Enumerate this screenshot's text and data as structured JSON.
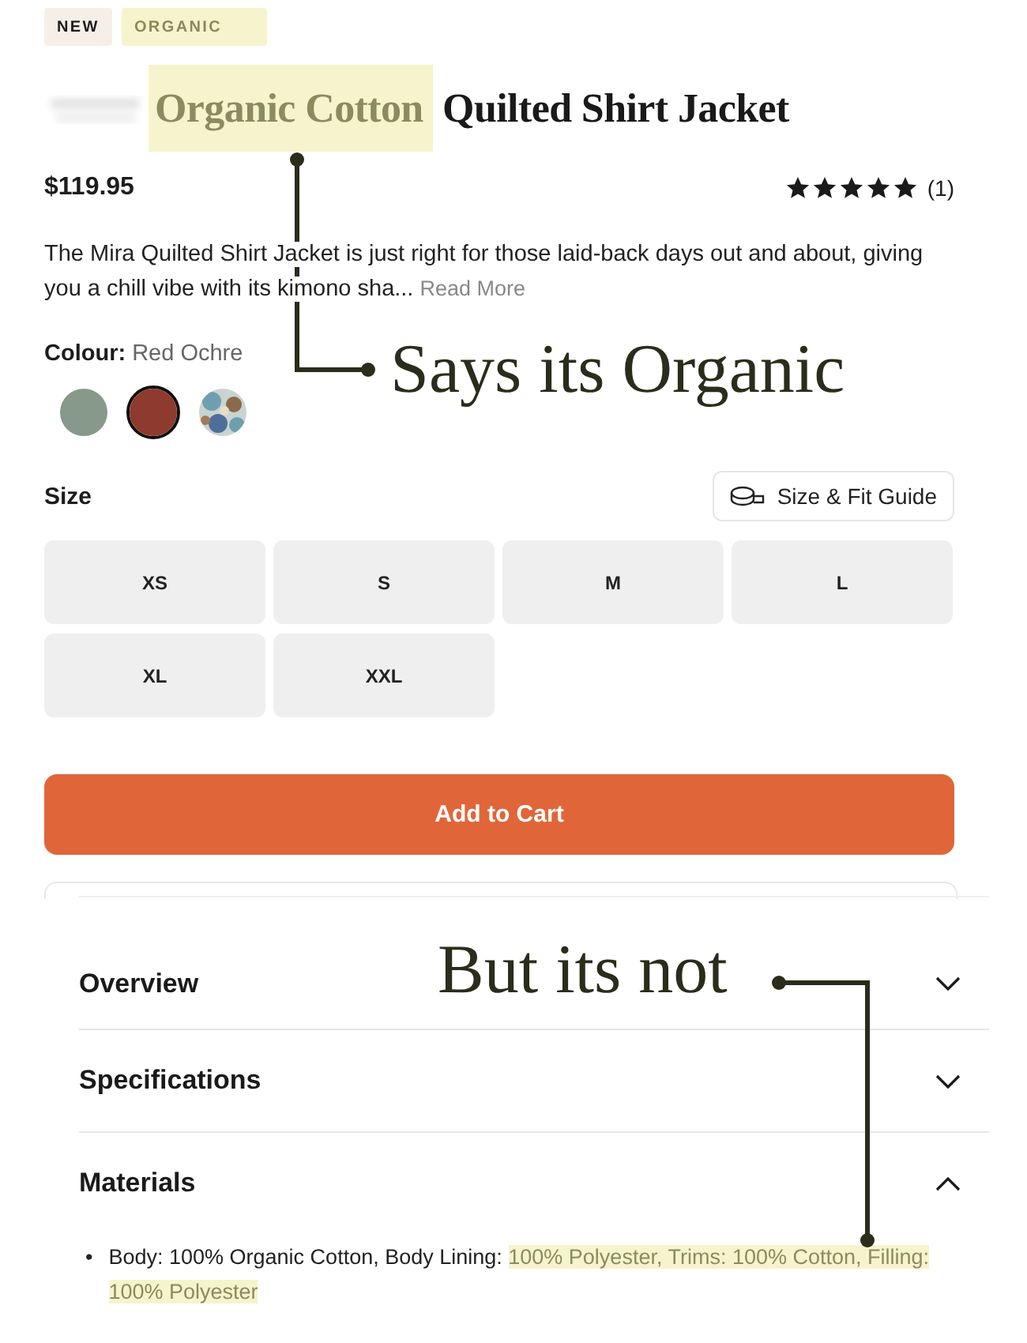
{
  "tags": [
    {
      "label": "NEW",
      "highlighted": false
    },
    {
      "label": "ORGANIC",
      "highlighted": true
    }
  ],
  "title": {
    "parts": [
      {
        "text": "Organic Cotton",
        "highlighted": true
      },
      {
        "text": " Quilted Shirt Jacket",
        "highlighted": false
      }
    ]
  },
  "price": "$119.95",
  "rating": {
    "stars": 5,
    "count": "(1)"
  },
  "description": "The Mira Quilted Shirt Jacket is just right for those laid-back days out and about, giving you a chill vibe with its kimono sha...",
  "read_more": "Read More",
  "colour": {
    "label": "Colour:",
    "value": "Red Ochre",
    "swatches": [
      {
        "kind": "solid",
        "color": "#87998a",
        "selected": false
      },
      {
        "kind": "solid",
        "color": "#8f3a2e",
        "selected": true
      },
      {
        "kind": "pattern",
        "color": "#6f9fae",
        "selected": false
      }
    ]
  },
  "size": {
    "label": "Size",
    "guide": "Size & Fit Guide",
    "options": [
      {
        "label": "XS",
        "selected": false
      },
      {
        "label": "S",
        "selected": false
      },
      {
        "label": "M",
        "selected": false
      },
      {
        "label": "L",
        "selected": false
      },
      {
        "label": "XL",
        "selected": false
      },
      {
        "label": "XXL",
        "selected": false
      }
    ]
  },
  "add_to_cart": "Add to Cart",
  "accordion": [
    {
      "title": "Overview",
      "expanded": false
    },
    {
      "title": "Specifications",
      "expanded": false
    },
    {
      "title": "Materials",
      "expanded": true,
      "marker": "•",
      "content": [
        {
          "text": "Body: 100% Organic Cotton, Body Lining: ",
          "highlighted": false
        },
        {
          "text": "100% Polyester, Trims: 100% Cotton, Filling: 100% Polyester",
          "highlighted": true
        }
      ]
    }
  ],
  "annotations": [
    {
      "text": "Says its Organic"
    },
    {
      "text": "But its not"
    }
  ]
}
